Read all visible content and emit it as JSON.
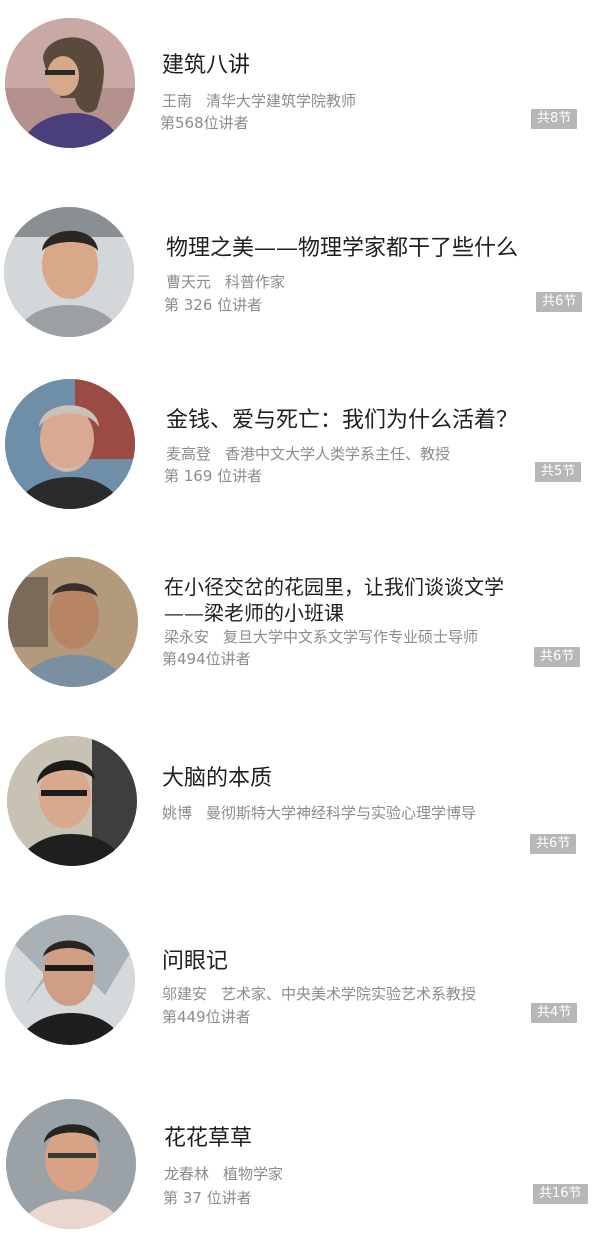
{
  "courses": [
    {
      "title": "建筑八讲",
      "lecturer_name": "王南",
      "lecturer_title": "清华大学建筑学院教师",
      "rank": "第568位讲者",
      "sessions": "共8节"
    },
    {
      "title": "物理之美——物理学家都干了些什么",
      "lecturer_name": "曹天元",
      "lecturer_title": "科普作家",
      "rank": "第 326 位讲者",
      "sessions": "共6节"
    },
    {
      "title": "金钱、爱与死亡：我们为什么活着？",
      "lecturer_name": "麦高登",
      "lecturer_title": "香港中文大学人类学系主任、教授",
      "rank": "第 169 位讲者",
      "sessions": "共5节"
    },
    {
      "title": "在小径交岔的花园里，让我们谈谈文学",
      "title_line2": "——梁老师的小班课",
      "lecturer_name": "梁永安",
      "lecturer_title": "复旦大学中文系文学写作专业硕士导师",
      "rank": "第494位讲者",
      "sessions": "共6节"
    },
    {
      "title": "大脑的本质",
      "lecturer_name": "姚博",
      "lecturer_title": "曼彻斯特大学神经科学与实验心理学博导",
      "rank": "",
      "sessions": "共6节"
    },
    {
      "title": "问眼记",
      "lecturer_name": "邬建安",
      "lecturer_title": "艺术家、中央美术学院实验艺术系教授",
      "rank": "第449位讲者",
      "sessions": "共4节"
    },
    {
      "title": "花花草草",
      "lecturer_name": "龙春林",
      "lecturer_title": "植物学家",
      "rank": "第 37 位讲者",
      "sessions": "共16节"
    }
  ],
  "colors": {
    "title": "#1f1f1f",
    "meta": "#8c8c8c",
    "badge_bg": "#b7b7b7",
    "badge_text": "#ffffff"
  }
}
